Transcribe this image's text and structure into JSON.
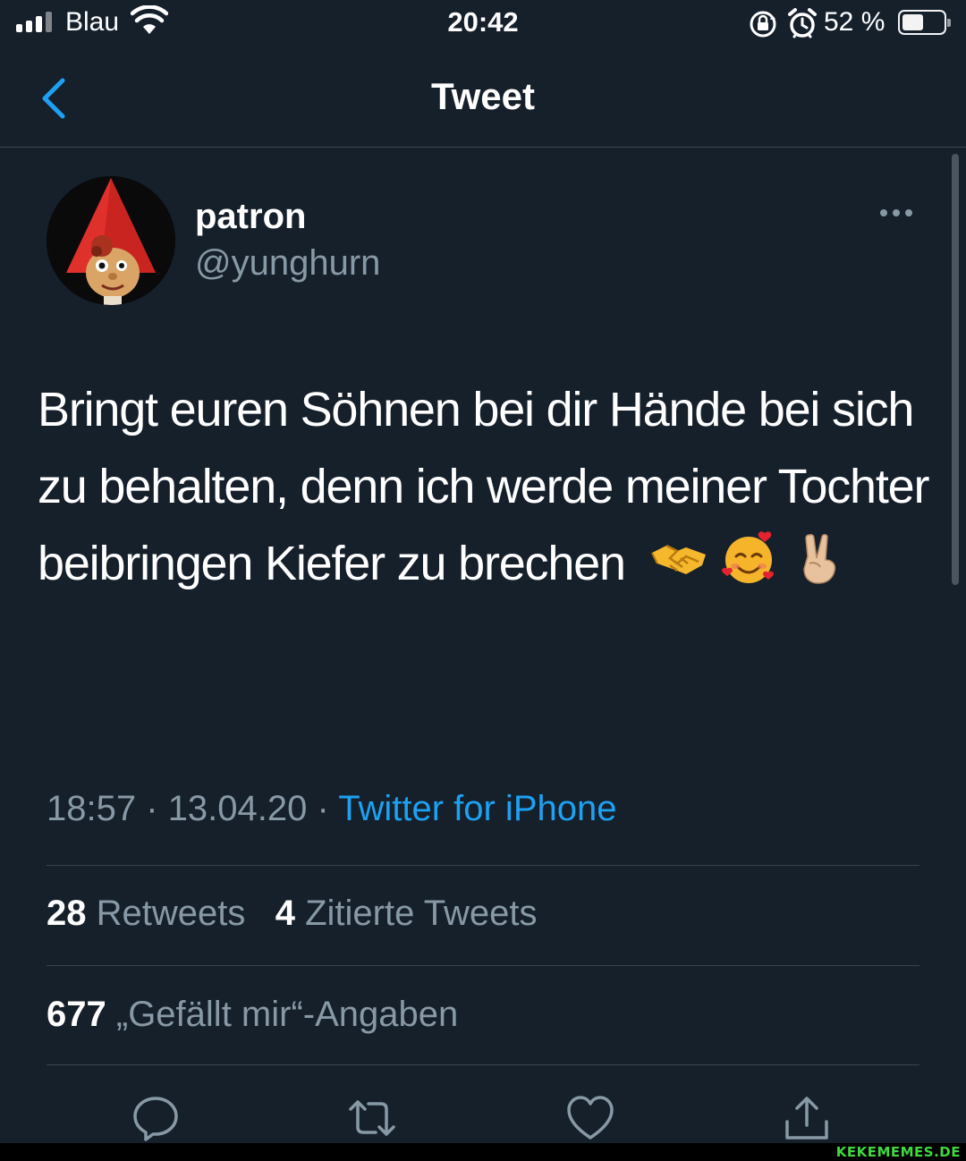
{
  "status_bar": {
    "carrier": "Blau",
    "time": "20:42",
    "battery_pct": "52 %",
    "battery_level": 0.52
  },
  "nav": {
    "title": "Tweet"
  },
  "tweet": {
    "display_name": "patron",
    "handle": "@yunghurn",
    "text": "Bringt euren Söhnen bei dir Hände bei sich zu behalten, denn ich werde meiner Tochter beibringen Kiefer zu brechen",
    "emojis": [
      "handshake-emoji",
      "smiling-face-with-hearts-emoji",
      "victory-hand-emoji"
    ],
    "time": "18:57",
    "separator": "·",
    "date": "13.04.20",
    "source": "Twitter for iPhone"
  },
  "stats": {
    "retweets_count": "28",
    "retweets_label": "Retweets",
    "quotes_count": "4",
    "quotes_label": "Zitierte Tweets",
    "likes_count": "677",
    "likes_label": "„Gefällt mir“-Angaben"
  },
  "actions": [
    "reply-icon",
    "retweet-icon",
    "like-icon",
    "share-icon"
  ],
  "colors": {
    "background": "#15202b",
    "accent": "#1da1f2",
    "secondary_text": "#8899a6",
    "divider": "#38444d"
  },
  "watermark": "KEKEMEMES.DE"
}
